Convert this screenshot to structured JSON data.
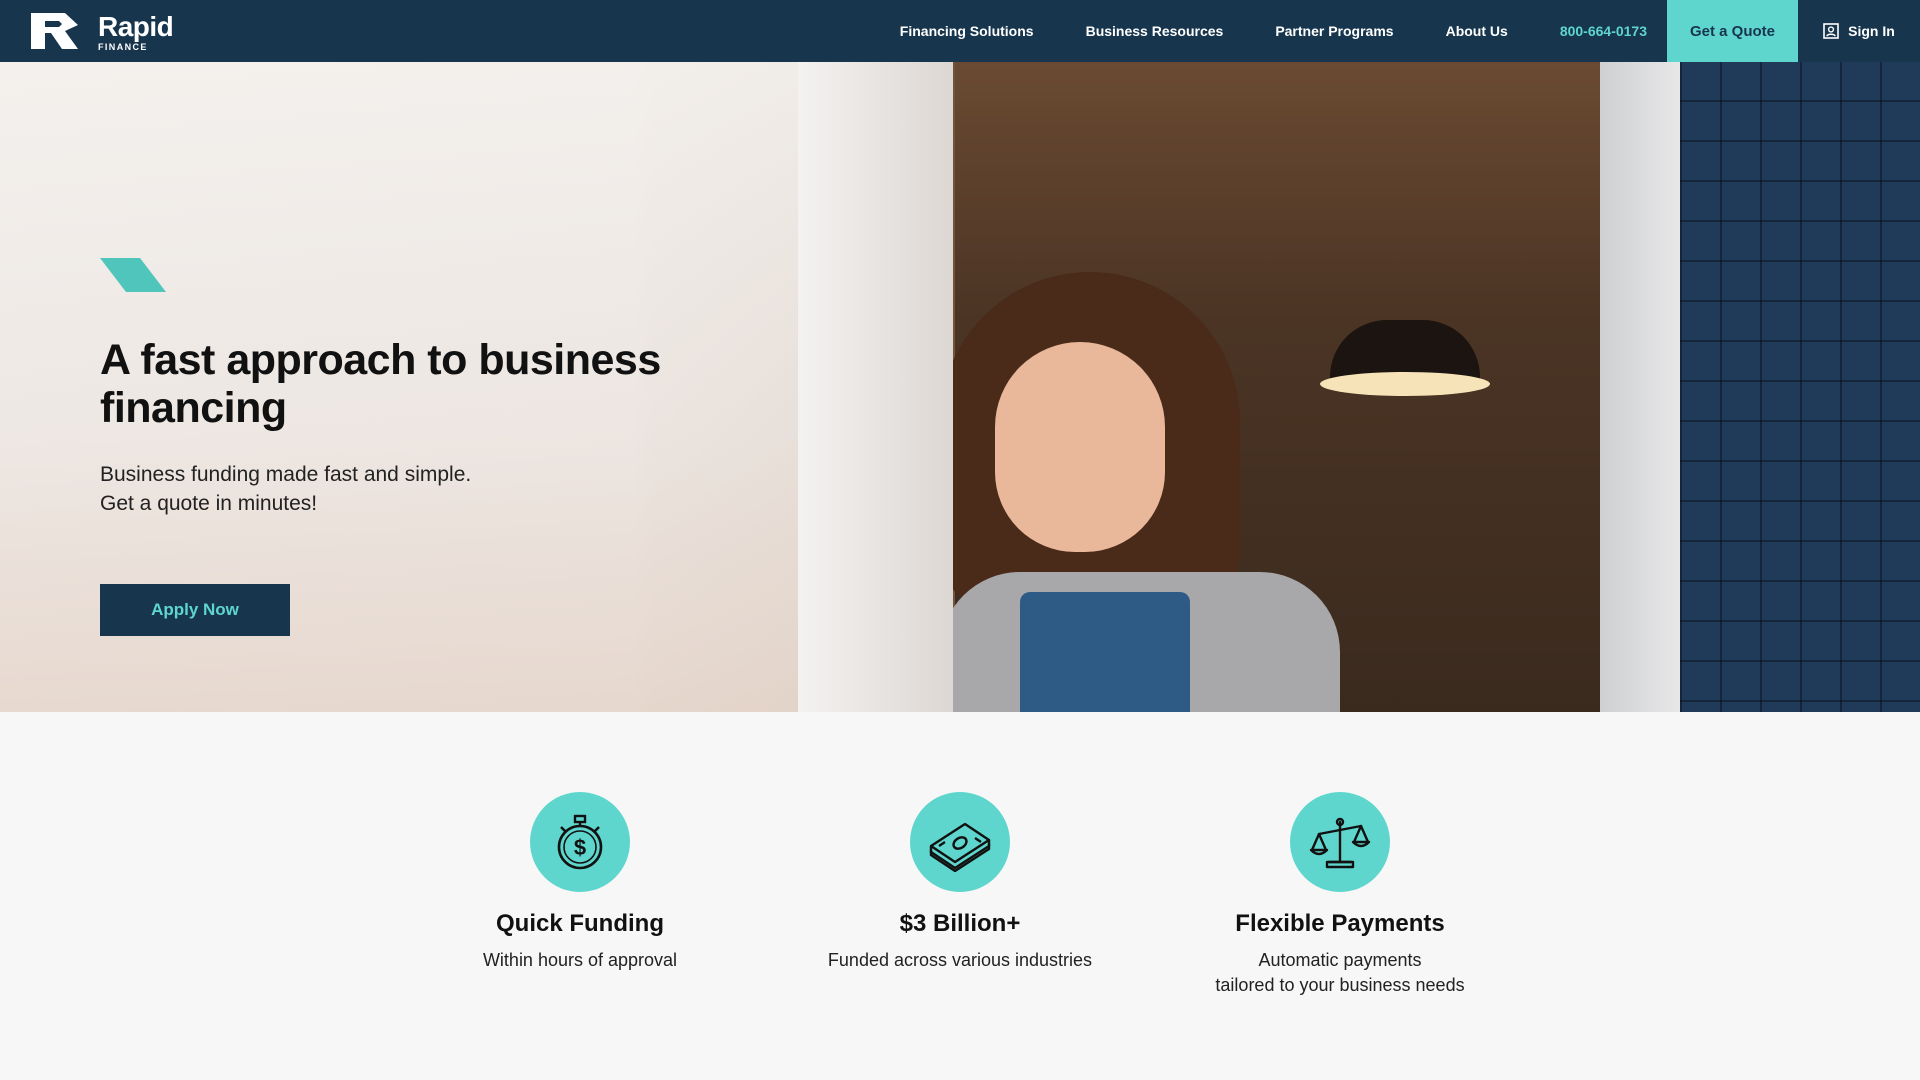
{
  "nav": {
    "logo_word": "Rapid",
    "logo_sub": "FINANCE",
    "links": [
      "Financing Solutions",
      "Business Resources",
      "Partner Programs",
      "About Us"
    ],
    "phone": "800-664-0173",
    "quote_label": "Get a Quote",
    "signin_label": "Sign In"
  },
  "hero": {
    "title": "A fast approach to business financing",
    "subtitle_line1": "Business funding made fast and simple.",
    "subtitle_line2": "Get a quote in minutes!",
    "cta_label": "Apply Now"
  },
  "features": [
    {
      "icon": "stopwatch-dollar-icon",
      "title": "Quick Funding",
      "desc": "Within hours of approval"
    },
    {
      "icon": "money-stack-icon",
      "title": "$3 Billion+",
      "desc": "Funded across various industries"
    },
    {
      "icon": "balance-scale-icon",
      "title": "Flexible Payments",
      "desc_line1": "Automatic payments",
      "desc_line2": "tailored to your business needs"
    }
  ],
  "colors": {
    "navy": "#17364e",
    "teal": "#5fd6cd",
    "background": "#f7f7f7"
  }
}
